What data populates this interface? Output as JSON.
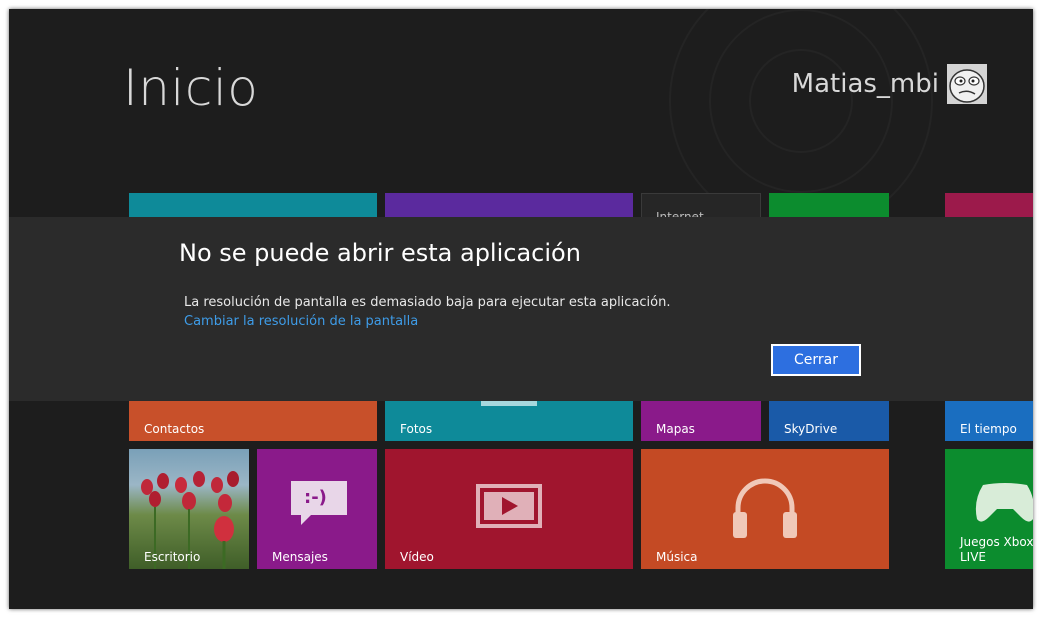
{
  "start": {
    "title": "Inicio",
    "user_name": "Matias_mbi"
  },
  "tiles": {
    "top_row_partial_label": "Internet ...",
    "contactos": "Contactos",
    "fotos": "Fotos",
    "mapas": "Mapas",
    "skydrive": "SkyDrive",
    "tiempo": "El tiempo",
    "escritorio": "Escritorio",
    "mensajes": "Mensajes",
    "video": "Vídeo",
    "musica": "Música",
    "xbox": "Juegos Xbox LIVE",
    "mensajes_glyph": ":-)"
  },
  "dialog": {
    "title": "No se puede abrir esta aplicación",
    "message": "La resolución de pantalla es demasiado baja para ejecutar esta aplicación.",
    "link": "Cambiar la resolución de la pantalla",
    "close_button": "Cerrar"
  },
  "colors": {
    "background": "#1d1d1d",
    "dialog_bg": "#2b2b2b",
    "accent_button": "#2d6fe0",
    "link": "#3e9ce8",
    "tile_teal": "#0e8a99",
    "tile_purple": "#5b2a9e",
    "tile_green": "#0c8c2e",
    "tile_crimson": "#9c1a4b",
    "tile_orange": "#c8502a",
    "tile_magenta": "#8a1a8a",
    "tile_blue": "#1a5aa8",
    "tile_red": "#9c1c3a",
    "tile_video": "#a0152e",
    "tile_music": "#c44a24"
  }
}
